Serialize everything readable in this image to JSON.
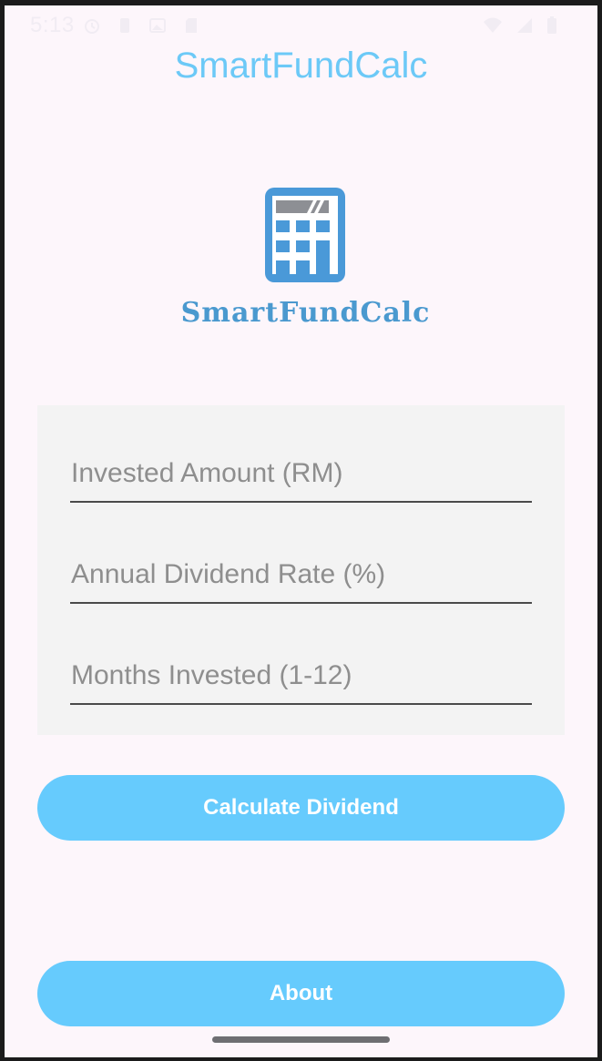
{
  "status_bar": {
    "time": "5:13",
    "left_icons": [
      "alarm-icon",
      "notification-icon",
      "photo-icon",
      "sd-card-icon"
    ],
    "right_icons": [
      "wifi-icon",
      "signal-icon",
      "battery-icon"
    ]
  },
  "app": {
    "title": "SmartFundCalc",
    "logo_text": "SmartFundCalc"
  },
  "form": {
    "invested_amount": {
      "placeholder": "Invested Amount (RM)",
      "value": ""
    },
    "dividend_rate": {
      "placeholder": "Annual Dividend Rate (%)",
      "value": ""
    },
    "months_invested": {
      "placeholder": "Months Invested (1-12)",
      "value": ""
    }
  },
  "buttons": {
    "calculate_label": "Calculate Dividend",
    "about_label": "About"
  },
  "colors": {
    "background": "#fdf6fb",
    "accent": "#66cbfd",
    "title": "#6cc9f7",
    "logo_blue": "#4a99cf",
    "card": "#f3f3f3"
  }
}
